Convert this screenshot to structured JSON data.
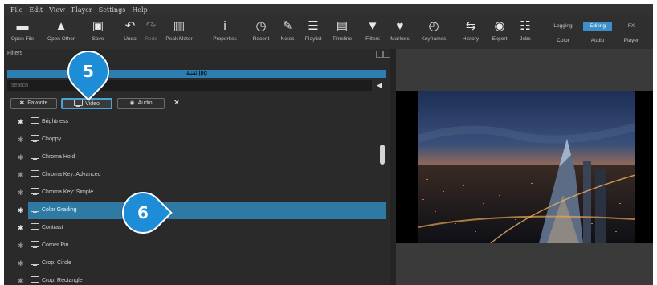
{
  "menu": [
    "File",
    "Edit",
    "View",
    "Player",
    "Settings",
    "Help"
  ],
  "toolbar": [
    {
      "label": "Open File",
      "icon": "folder-open-icon",
      "glyph": "▬",
      "disabled": false
    },
    {
      "label": "Open Other",
      "icon": "open-other-icon",
      "glyph": "▲",
      "disabled": false
    },
    {
      "label": "Save",
      "icon": "save-icon",
      "glyph": "▣",
      "disabled": false
    },
    {
      "label": "Undo",
      "icon": "undo-icon",
      "glyph": "↶",
      "disabled": false
    },
    {
      "label": "Redo",
      "icon": "redo-icon",
      "glyph": "↷",
      "disabled": true
    },
    {
      "label": "Peak Meter",
      "icon": "peak-meter-icon",
      "glyph": "▥",
      "disabled": false
    },
    {
      "label": "Properties",
      "icon": "properties-icon",
      "glyph": "i",
      "disabled": false
    },
    {
      "label": "Recent",
      "icon": "recent-icon",
      "glyph": "◷",
      "disabled": false
    },
    {
      "label": "Notes",
      "icon": "notes-icon",
      "glyph": "✎",
      "disabled": false
    },
    {
      "label": "Playlist",
      "icon": "playlist-icon",
      "glyph": "☰",
      "disabled": false
    },
    {
      "label": "Timeline",
      "icon": "timeline-icon",
      "glyph": "▤",
      "disabled": false
    },
    {
      "label": "Filters",
      "icon": "filters-icon",
      "glyph": "▼",
      "disabled": false
    },
    {
      "label": "Markers",
      "icon": "markers-icon",
      "glyph": "♥",
      "disabled": false
    },
    {
      "label": "Keyframes",
      "icon": "keyframes-icon",
      "glyph": "◴",
      "disabled": false
    },
    {
      "label": "History",
      "icon": "history-icon",
      "glyph": "⇆",
      "disabled": false
    },
    {
      "label": "Export",
      "icon": "export-icon",
      "glyph": "◉",
      "disabled": false
    },
    {
      "label": "Jobs",
      "icon": "jobs-icon",
      "glyph": "☷",
      "disabled": false
    }
  ],
  "workspaces": {
    "top": [
      "Logging",
      "Editing",
      "FX"
    ],
    "bottom": [
      "Color",
      "Audio",
      "Player"
    ],
    "active": "Editing"
  },
  "filters_panel": {
    "title": "Filters",
    "clip_name": "تقنية.jpg",
    "search_placeholder": "search",
    "tabs": [
      {
        "label": "Favorite",
        "icon": "star-icon",
        "glyph": "✱",
        "active": false
      },
      {
        "label": "Video",
        "icon": "monitor-icon",
        "glyph": "",
        "active": true
      },
      {
        "label": "Audio",
        "icon": "speaker-icon",
        "glyph": "◉",
        "active": false
      }
    ],
    "items": [
      {
        "label": "Brightness",
        "favorite": true,
        "selected": false
      },
      {
        "label": "Choppy",
        "favorite": false,
        "selected": false
      },
      {
        "label": "Chroma Hold",
        "favorite": false,
        "selected": false
      },
      {
        "label": "Chroma Key: Advanced",
        "favorite": false,
        "selected": false
      },
      {
        "label": "Chroma Key: Simple",
        "favorite": false,
        "selected": false
      },
      {
        "label": "Color Grading",
        "favorite": true,
        "selected": true
      },
      {
        "label": "Contrast",
        "favorite": true,
        "selected": false
      },
      {
        "label": "Corner Pin",
        "favorite": false,
        "selected": false
      },
      {
        "label": "Crop: Circle",
        "favorite": false,
        "selected": false
      },
      {
        "label": "Crop: Rectangle",
        "favorite": false,
        "selected": false
      }
    ]
  },
  "callouts": {
    "video_tab": "5",
    "color_grading_row": "6"
  },
  "colors": {
    "accent": "#2e7aa5",
    "callout": "#1e8dd8",
    "clip_bar": "#2d7fb3"
  }
}
